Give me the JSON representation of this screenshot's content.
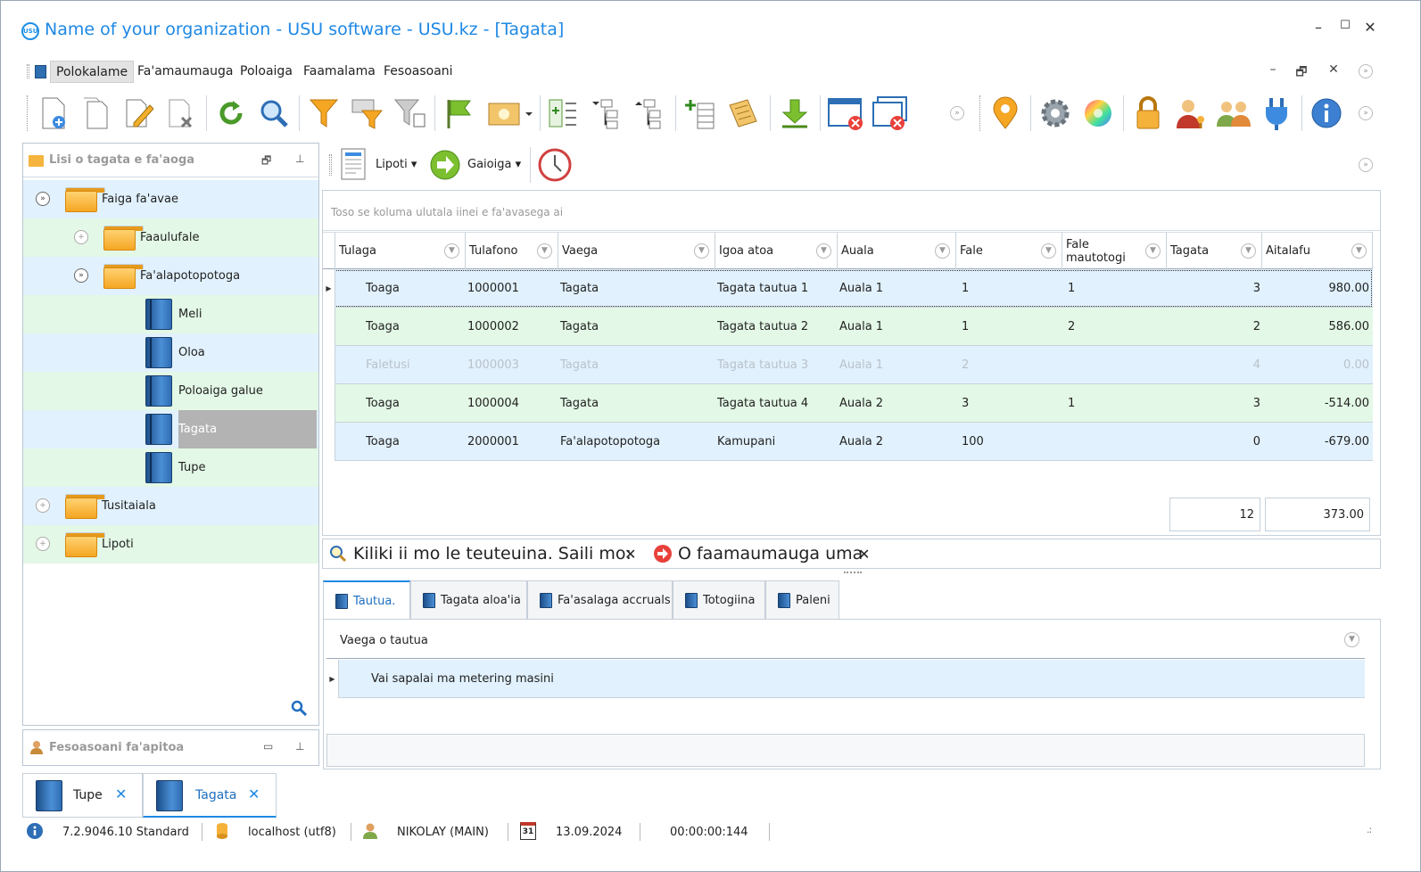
{
  "window": {
    "title": "Name of your organization - USU software - USU.kz - [Tagata]",
    "logo_text": "USU",
    "controls": {
      "minimize": "–",
      "maximize": "☐",
      "close": "✕"
    }
  },
  "menu": {
    "items": [
      "Polokalame",
      "Fa'amaumauga",
      "Poloaiga",
      "Faamalama",
      "Fesoasoani"
    ],
    "mdi_controls": {
      "minimize": "–",
      "restore": "🗗",
      "close": "✕"
    }
  },
  "left_panel": {
    "title": "Lisi o tagata e fa'aoga",
    "tree": [
      {
        "label": "Faiga fa'avae"
      },
      {
        "label": "Faaulufale"
      },
      {
        "label": "Fa'alapotopotoga"
      },
      {
        "label": "Meli"
      },
      {
        "label": "Oloa"
      },
      {
        "label": "Poloaiga galue"
      },
      {
        "label": "Tagata"
      },
      {
        "label": "Tupe"
      },
      {
        "label": "Tusitaiala"
      },
      {
        "label": "Lipoti"
      }
    ],
    "help_title": "Fesoasoani fa'apitoa"
  },
  "report_toolbar": {
    "report_label": "Lipoti",
    "action_label": "Gaioiga"
  },
  "grid": {
    "filter_hint": "Toso se koluma ulutala iinei e fa'avasega ai",
    "columns": [
      "Tulaga",
      "Tulafono",
      "Vaega",
      "Igoa atoa",
      "Auala",
      "Fale",
      "Fale mautotogi",
      "Tagata",
      "Aitalafu"
    ],
    "rows": [
      {
        "status": "Toaga",
        "code": "1000001",
        "group": "Tagata",
        "name": "Tagata tautua 1",
        "road": "Auala 1",
        "house": "1",
        "apt": "1",
        "people": "3",
        "debt": "980.00"
      },
      {
        "status": "Toaga",
        "code": "1000002",
        "group": "Tagata",
        "name": "Tagata tautua 2",
        "road": "Auala 1",
        "house": "1",
        "apt": "2",
        "people": "2",
        "debt": "586.00"
      },
      {
        "status": "Faletusi",
        "code": "1000003",
        "group": "Tagata",
        "name": "Tagata tautua 3",
        "road": "Auala 1",
        "house": "2",
        "apt": "",
        "people": "4",
        "debt": "0.00"
      },
      {
        "status": "Toaga",
        "code": "1000004",
        "group": "Tagata",
        "name": "Tagata tautua 4",
        "road": "Auala 2",
        "house": "3",
        "apt": "1",
        "people": "3",
        "debt": "-514.00"
      },
      {
        "status": "Toaga",
        "code": "2000001",
        "group": "Fa'alapotopotoga",
        "name": "Kamupani",
        "road": "Auala 2",
        "house": "100",
        "apt": "",
        "people": "0",
        "debt": "-679.00"
      }
    ],
    "totals": {
      "people": "12",
      "debt": "373.00"
    }
  },
  "filterbar": {
    "search_text": "Kiliki ii mo le teuteuina. Saili mo:",
    "filter_text": "O faamaumauga uma"
  },
  "tabs": [
    "Tautua.",
    "Tagata aloa'ia",
    "Fa'asalaga accruals",
    "Totogiina",
    "Paleni"
  ],
  "subgrid": {
    "column": "Vaega o tautua",
    "rows": [
      "Vai sapalai ma metering masini"
    ]
  },
  "doc_tabs": [
    "Tupe",
    "Tagata"
  ],
  "status": {
    "version": "7.2.9046.10 Standard",
    "db": "localhost (utf8)",
    "user": "NIKOLAY (MAIN)",
    "calendar_day": "31",
    "date": "13.09.2024",
    "timer": "00:00:00:144"
  },
  "colors": {
    "accent": "#1e88e5",
    "row_blue": "#e1f1fd",
    "row_green": "#e3f8e6",
    "selected": "#b3b3b3"
  }
}
